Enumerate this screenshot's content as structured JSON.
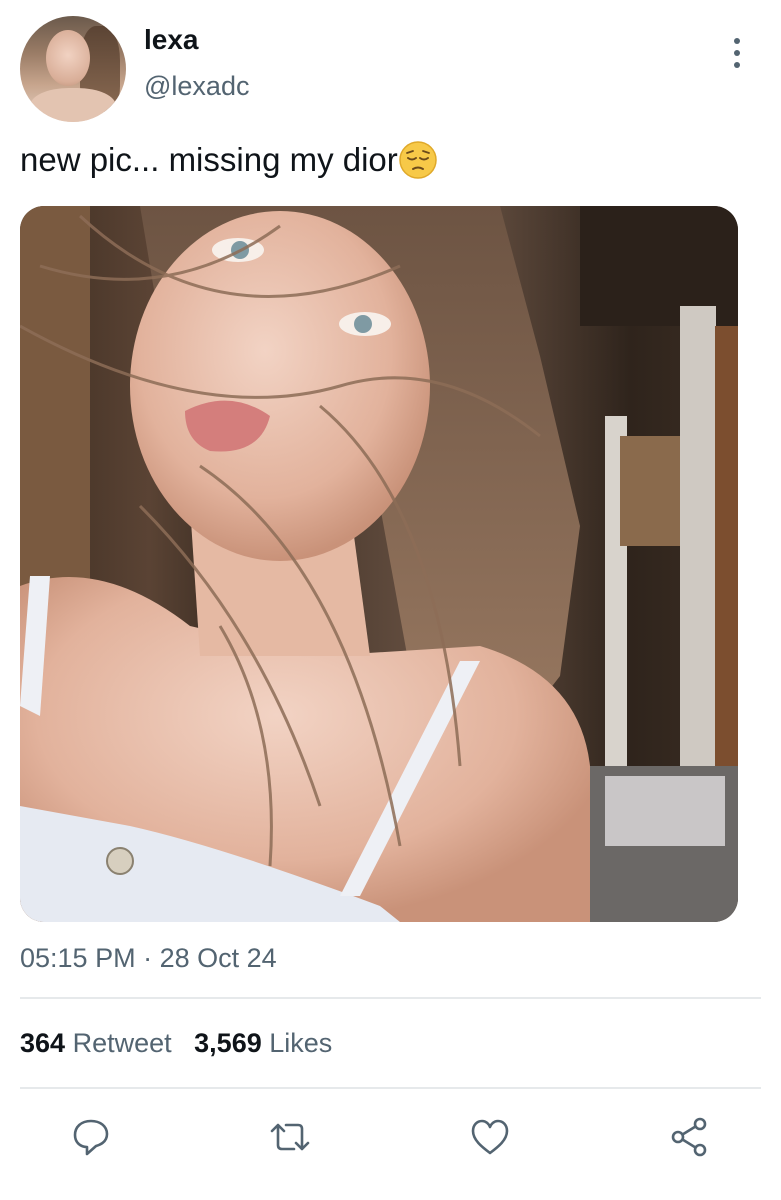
{
  "author": {
    "display_name": "lexa",
    "handle": "@lexadc"
  },
  "tweet": {
    "text": "new pic... missing my dior",
    "emoji_icon": "pensive-face-icon"
  },
  "meta": {
    "time": "05:15 PM",
    "separator": "·",
    "date": "28 Oct 24"
  },
  "stats": {
    "retweets": "364",
    "retweets_label": "Retweet",
    "likes": "3,569",
    "likes_label": "Likes"
  },
  "actions": [
    "reply-icon",
    "retweet-icon",
    "like-icon",
    "share-icon"
  ],
  "colors": {
    "text_primary": "#0f1419",
    "text_secondary": "#536471",
    "divider": "#e6e9eb"
  }
}
